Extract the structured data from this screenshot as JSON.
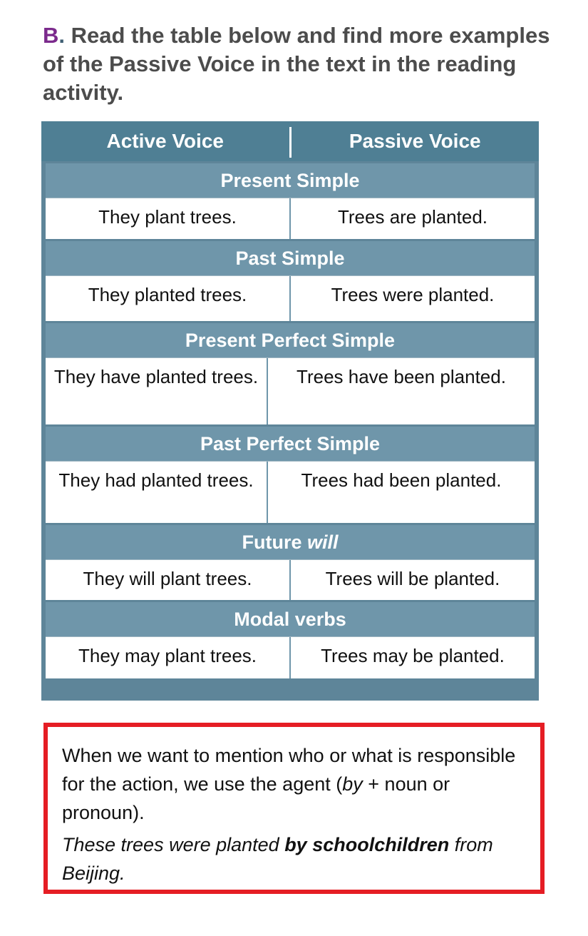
{
  "instruction": {
    "letter": "B",
    "punct": ".",
    "text": " Read the table below and find more examples of the Passive Voice in the text in the reading activity."
  },
  "table": {
    "headers": {
      "active": "Active Voice",
      "passive": "Passive Voice"
    },
    "sections": [
      {
        "title": "Present Simple",
        "active": "They plant trees.",
        "passive": "Trees are planted."
      },
      {
        "title": "Past Simple",
        "active": "They planted trees.",
        "passive": "Trees were planted."
      },
      {
        "title": "Present Perfect Simple",
        "active": "They have planted trees.",
        "passive": "Trees have been planted."
      },
      {
        "title": "Past Perfect Simple",
        "active": "They had planted trees.",
        "passive": "Trees had been planted."
      },
      {
        "title_plain": "Future ",
        "title_italic": "will",
        "active": "They will plant trees.",
        "passive": "Trees will be planted."
      },
      {
        "title": "Modal verbs",
        "active": "They may plant trees.",
        "passive": "Trees may be planted."
      }
    ]
  },
  "note": {
    "rule_part1": "When we want to mention who or what is responsible for the action, we use the agent (",
    "rule_italic": "by",
    "rule_part2": " + noun or pronoun).",
    "example_part1": "These trees were planted ",
    "example_bold": "by schoolchildren",
    "example_part2": " from Beijing."
  },
  "colors": {
    "header_bg": "#4f7f94",
    "section_bg": "#6f96aa",
    "note_border": "#e51d24",
    "letter_accent": "#7b2a8c"
  }
}
